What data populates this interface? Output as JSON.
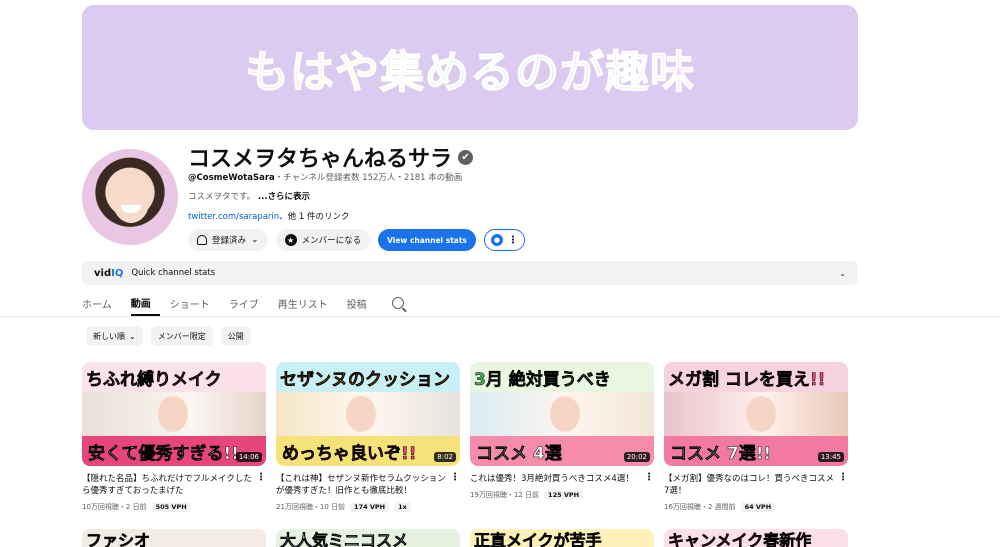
{
  "banner": {
    "text": "もはや集めるのが趣味"
  },
  "channel": {
    "name": "コスメヲタちゃんねるサラ",
    "verified_icon": "✔",
    "handle": "@CosmeWotaSara",
    "meta": "・チャンネル登録者数 152万人・2181 本の動画",
    "description": "コスメヲタです。",
    "more": "...さらに表示",
    "link": "twitter.com/saraparin",
    "other_links": "、他 1 件のリンク"
  },
  "buttons": {
    "subscribed": "登録済み",
    "member": "メンバーになる",
    "stats": "View channel stats"
  },
  "vidiq": {
    "logo_a": "vid",
    "logo_b": "IQ",
    "label": "Quick channel stats"
  },
  "tabs": [
    "ホーム",
    "動画",
    "ショート",
    "ライブ",
    "再生リスト",
    "投稿"
  ],
  "active_tab": "動画",
  "chips": [
    "新しい順",
    "メンバー限定",
    "公開"
  ],
  "videos": [
    {
      "thumb_top": "ちふれ縛りメイク",
      "thumb_bottom": "安くて優秀すぎる!!",
      "duration": "14:06",
      "title": "【隠れた名品】ちふれだけでフルメイクしたら優秀すぎておったまげた",
      "views": "10万回視聴・2 日前",
      "vph": "505 VPH",
      "extra": ""
    },
    {
      "thumb_top": "セザンヌのクッション",
      "thumb_bottom": "めっちゃ良いぞ!!",
      "duration": "8:02",
      "title": "【これは神】セザンヌ新作セラムクッションが優秀すぎた！旧作とも徹底比較！",
      "views": "21万回視聴・10 日前",
      "vph": "174 VPH",
      "extra": "1x"
    },
    {
      "thumb_top": "3月 絶対買うべき",
      "thumb_bottom": "コスメ 4選",
      "duration": "20:02",
      "title": "これは優秀！3月絶対買うべきコスメ4選！",
      "views": "19万回視聴・12 日前",
      "vph": "125 VPH",
      "extra": ""
    },
    {
      "thumb_top": "メガ割 コレを買え!!",
      "thumb_bottom": "コスメ 7選!!",
      "duration": "13:45",
      "title": "【メガ割】優秀なのはコレ！買うべきコスメ7選！",
      "views": "16万回視聴・2 週間前",
      "vph": "64 VPH",
      "extra": ""
    }
  ],
  "row2": [
    "ファシオ",
    "大人気ミニコスメ",
    "正直メイクが苦手",
    "キャンメイク春新作"
  ]
}
